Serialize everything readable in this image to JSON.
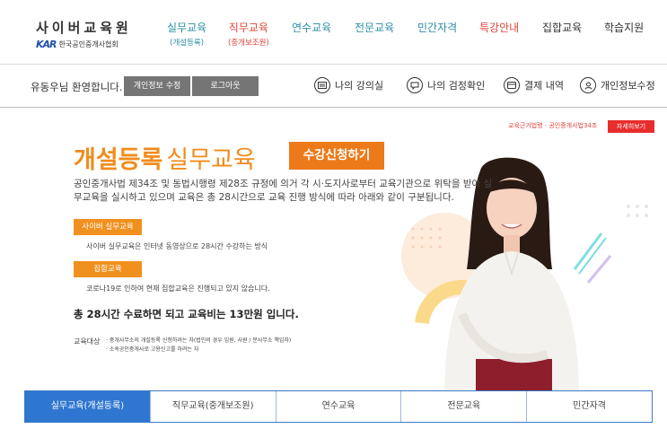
{
  "logo": {
    "title": "사이버교육원",
    "mark": "KAR",
    "org": "한국공인중개사협회"
  },
  "nav": [
    {
      "label": "실무교육",
      "sub": "(개설등록)",
      "tone": "blue"
    },
    {
      "label": "직무교육",
      "sub": "(중개보조원)",
      "tone": "red"
    },
    {
      "label": "연수교육",
      "sub": "",
      "tone": "blue"
    },
    {
      "label": "전문교육",
      "sub": "",
      "tone": "blue"
    },
    {
      "label": "민간자격",
      "sub": "",
      "tone": "blue"
    },
    {
      "label": "특강안내",
      "sub": "",
      "tone": "red"
    },
    {
      "label": "집합교육",
      "sub": "",
      "tone": "dark"
    },
    {
      "label": "학습지원",
      "sub": "",
      "tone": "dark"
    }
  ],
  "user": {
    "welcome": "유동우님 환영합니다.",
    "edit_info_button": "개인정보 수정",
    "logout_button": "로그아웃",
    "links": [
      {
        "label": "나의 강의실",
        "icon": "classroom-icon"
      },
      {
        "label": "나의 검정확인",
        "icon": "exam-check-icon"
      },
      {
        "label": "결제 내역",
        "icon": "payment-icon"
      },
      {
        "label": "개인정보수정",
        "icon": "profile-icon"
      }
    ]
  },
  "hero": {
    "law_note": "교육근거법령 · 공인중개사법34조",
    "detail_button": "자세히보기",
    "title_bold": "개설등록",
    "title_light": "실무교육",
    "apply_button": "수강신청하기",
    "intro": "공인중개사법 제34조 및 동법시행령 제28조 규정에 의거 각 시·도지사로부터 교육기관으로 위탁을 받아 실무교육을 실시하고 있으며 교육은 총 28시간으로 교육 진행 방식에 따라 아래와 같이 구분됩니다.",
    "badge1": "사이버 실무교육",
    "desc1": "사이버 실무교육은 인터넷 동영상으로 28시간 수강하는 방식",
    "badge2": "집합교육",
    "desc2": "코로나19로 인하여 현재 집합교육은 진행되고 있지 않습니다.",
    "fee": "총 28시간 수료하면 되고 교육비는 13만원 입니다.",
    "target_label": "교육대상",
    "target_items": [
      "· 중개사무소의 개설등록 신청하려는 자(법인의 경우 임원, 사원 / 분사무소 책임자)",
      "· 소속공인중개사로 고용신고를 하려는 자"
    ]
  },
  "tabs": [
    {
      "label": "실무교육(개설등록)",
      "active": true
    },
    {
      "label": "직무교육(중개보조원)",
      "active": false
    },
    {
      "label": "연수교육",
      "active": false
    },
    {
      "label": "전문교육",
      "active": false
    },
    {
      "label": "민간자격",
      "active": false
    }
  ],
  "colors": {
    "accent_orange": "#f08c1c",
    "accent_red": "#e82d2d",
    "tab_blue": "#2f76d0",
    "nav_teal": "#2c8ea6"
  }
}
